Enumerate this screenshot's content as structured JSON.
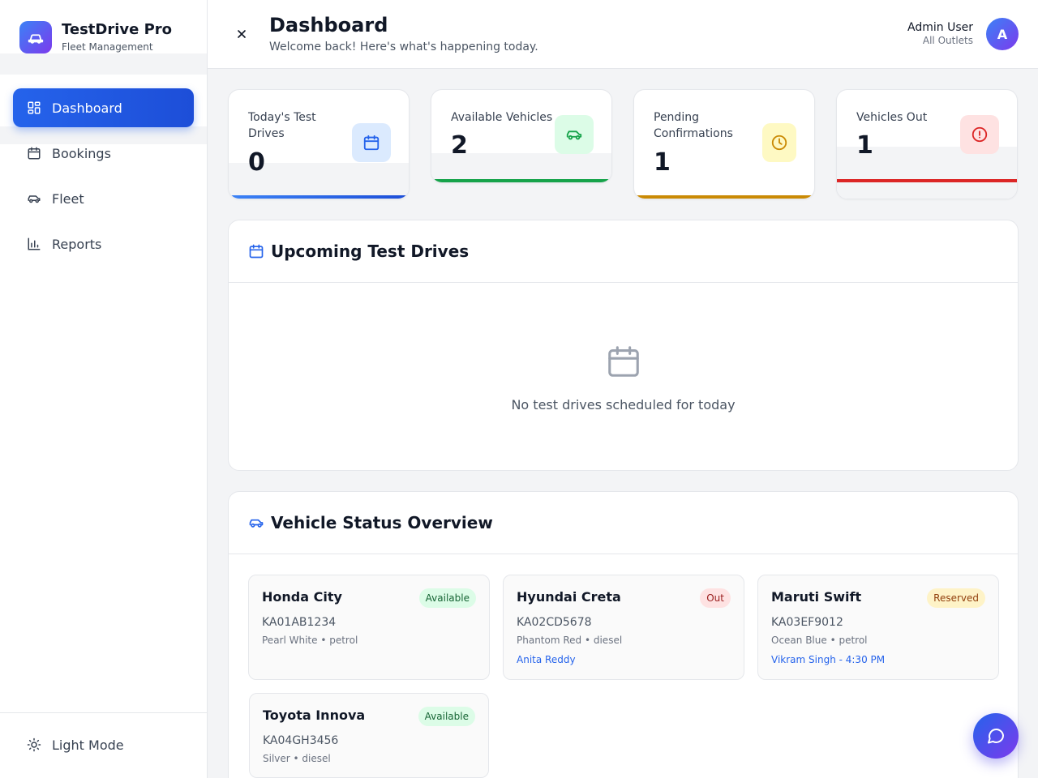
{
  "app": {
    "title": "TestDrive Pro",
    "subtitle": "Fleet Management"
  },
  "sidebar": {
    "items": [
      {
        "label": "Dashboard",
        "icon": "dashboard-grid-icon",
        "active": true
      },
      {
        "label": "Bookings",
        "icon": "calendar-icon",
        "active": false
      },
      {
        "label": "Fleet",
        "icon": "car-icon",
        "active": false
      },
      {
        "label": "Reports",
        "icon": "bar-chart-icon",
        "active": false
      }
    ],
    "theme_toggle": "Light Mode"
  },
  "header": {
    "title": "Dashboard",
    "subtitle": "Welcome back! Here's what's happening today.",
    "user_name": "Admin User",
    "user_scope": "All Outlets",
    "avatar_initial": "A"
  },
  "stats": [
    {
      "label": "Today's Test Drives",
      "value": "0",
      "icon": "calendar-icon",
      "color": "#2563eb"
    },
    {
      "label": "Available Vehicles",
      "value": "2",
      "icon": "car-icon",
      "color": "#16a34a"
    },
    {
      "label": "Pending Confirmations",
      "value": "1",
      "icon": "clock-icon",
      "color": "#ca8a04"
    },
    {
      "label": "Vehicles Out",
      "value": "1",
      "icon": "alert-circle-icon",
      "color": "#dc2626"
    }
  ],
  "upcoming": {
    "title": "Upcoming Test Drives",
    "empty_text": "No test drives scheduled for today"
  },
  "vehicles": {
    "title": "Vehicle Status Overview",
    "items": [
      {
        "name": "Honda City",
        "status": "Available",
        "plate": "KA01AB1234",
        "meta": "Pearl White • petrol",
        "assignment": ""
      },
      {
        "name": "Hyundai Creta",
        "status": "Out",
        "plate": "KA02CD5678",
        "meta": "Phantom Red • diesel",
        "assignment": "Anita Reddy"
      },
      {
        "name": "Maruti Swift",
        "status": "Reserved",
        "plate": "KA03EF9012",
        "meta": "Ocean Blue • petrol",
        "assignment": "Vikram Singh - 4:30 PM"
      },
      {
        "name": "Toyota Innova",
        "status": "Available",
        "plate": "KA04GH3456",
        "meta": "Silver • diesel",
        "assignment": ""
      }
    ]
  }
}
